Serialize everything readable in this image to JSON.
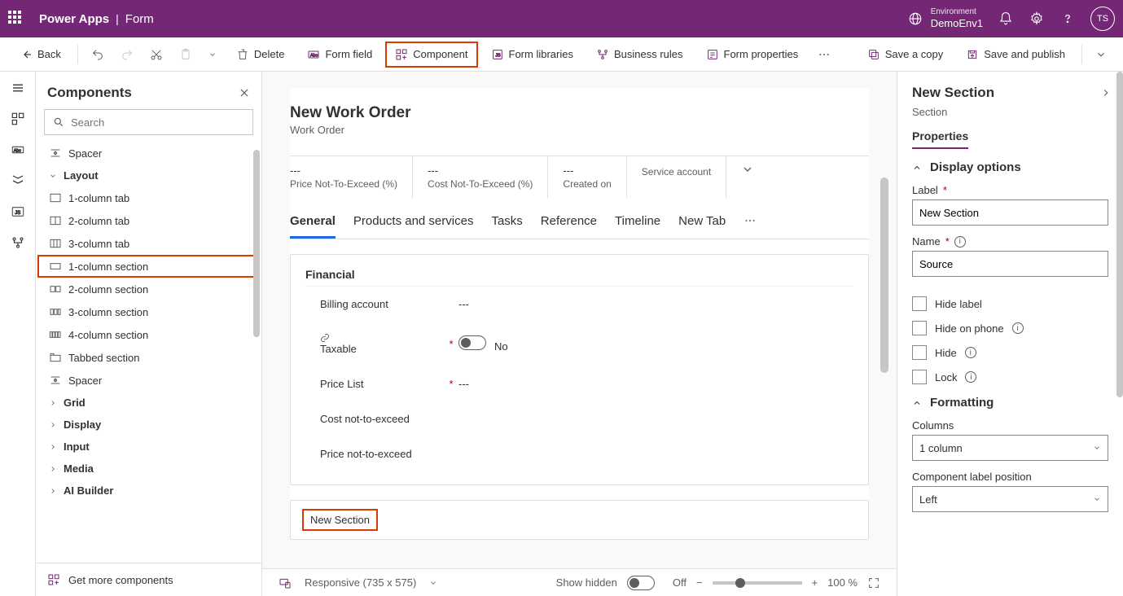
{
  "topbar": {
    "app": "Power Apps",
    "page": "Form",
    "env_label": "Environment",
    "env_name": "DemoEnv1",
    "avatar": "TS"
  },
  "cmdbar": {
    "back": "Back",
    "delete": "Delete",
    "form_field": "Form field",
    "component": "Component",
    "form_libraries": "Form libraries",
    "business_rules": "Business rules",
    "form_properties": "Form properties",
    "save_copy": "Save a copy",
    "save_publish": "Save and publish"
  },
  "left": {
    "title": "Components",
    "search_placeholder": "Search",
    "get_more": "Get more components",
    "rows": [
      {
        "type": "item",
        "icon": "spacer",
        "label": "Spacer"
      },
      {
        "type": "group",
        "label": "Layout"
      },
      {
        "type": "item",
        "icon": "tab1",
        "label": "1-column tab"
      },
      {
        "type": "item",
        "icon": "tab2",
        "label": "2-column tab"
      },
      {
        "type": "item",
        "icon": "tab3",
        "label": "3-column tab"
      },
      {
        "type": "item",
        "icon": "sec1",
        "label": "1-column section",
        "hl": true
      },
      {
        "type": "item",
        "icon": "sec2",
        "label": "2-column section"
      },
      {
        "type": "item",
        "icon": "sec3",
        "label": "3-column section"
      },
      {
        "type": "item",
        "icon": "sec4",
        "label": "4-column section"
      },
      {
        "type": "item",
        "icon": "tabbed",
        "label": "Tabbed section"
      },
      {
        "type": "item",
        "icon": "spacer",
        "label": "Spacer"
      },
      {
        "type": "group",
        "label": "Grid",
        "collapsed": true
      },
      {
        "type": "group",
        "label": "Display",
        "collapsed": true
      },
      {
        "type": "group",
        "label": "Input",
        "collapsed": true
      },
      {
        "type": "group",
        "label": "Media",
        "collapsed": true
      },
      {
        "type": "group",
        "label": "AI Builder",
        "collapsed": true
      }
    ]
  },
  "form": {
    "title": "New Work Order",
    "subtitle": "Work Order",
    "header_fields": [
      {
        "val": "---",
        "lab": "Price Not-To-Exceed (%)"
      },
      {
        "val": "---",
        "lab": "Cost Not-To-Exceed (%)"
      },
      {
        "val": "---",
        "lab": "Created on"
      },
      {
        "val": "",
        "lab": "Service account"
      }
    ],
    "tabs": [
      "General",
      "Products and services",
      "Tasks",
      "Reference",
      "Timeline",
      "New Tab"
    ],
    "section_financial": {
      "title": "Financial",
      "fields": [
        {
          "label": "Billing account",
          "req": false,
          "val": "---"
        },
        {
          "label": "Taxable",
          "req": true,
          "toggle": true,
          "val": "No",
          "link": true
        },
        {
          "label": "Price List",
          "req": true,
          "val": "---"
        },
        {
          "label": "Cost not-to-exceed",
          "req": false,
          "val": ""
        },
        {
          "label": "Price not-to-exceed",
          "req": false,
          "val": ""
        }
      ]
    },
    "new_section_label": "New Section"
  },
  "right": {
    "title": "New Section",
    "subtitle": "Section",
    "tab": "Properties",
    "display_options": "Display options",
    "label_label": "Label",
    "label_value": "New Section",
    "name_label": "Name",
    "name_value": "Source",
    "hide_label": "Hide label",
    "hide_phone": "Hide on phone",
    "hide": "Hide",
    "lock": "Lock",
    "formatting": "Formatting",
    "columns_label": "Columns",
    "columns_value": "1 column",
    "clp_label": "Component label position",
    "clp_value": "Left"
  },
  "footer": {
    "responsive": "Responsive (735 x 575)",
    "show_hidden": "Show hidden",
    "off": "Off",
    "zoom": "100 %"
  }
}
